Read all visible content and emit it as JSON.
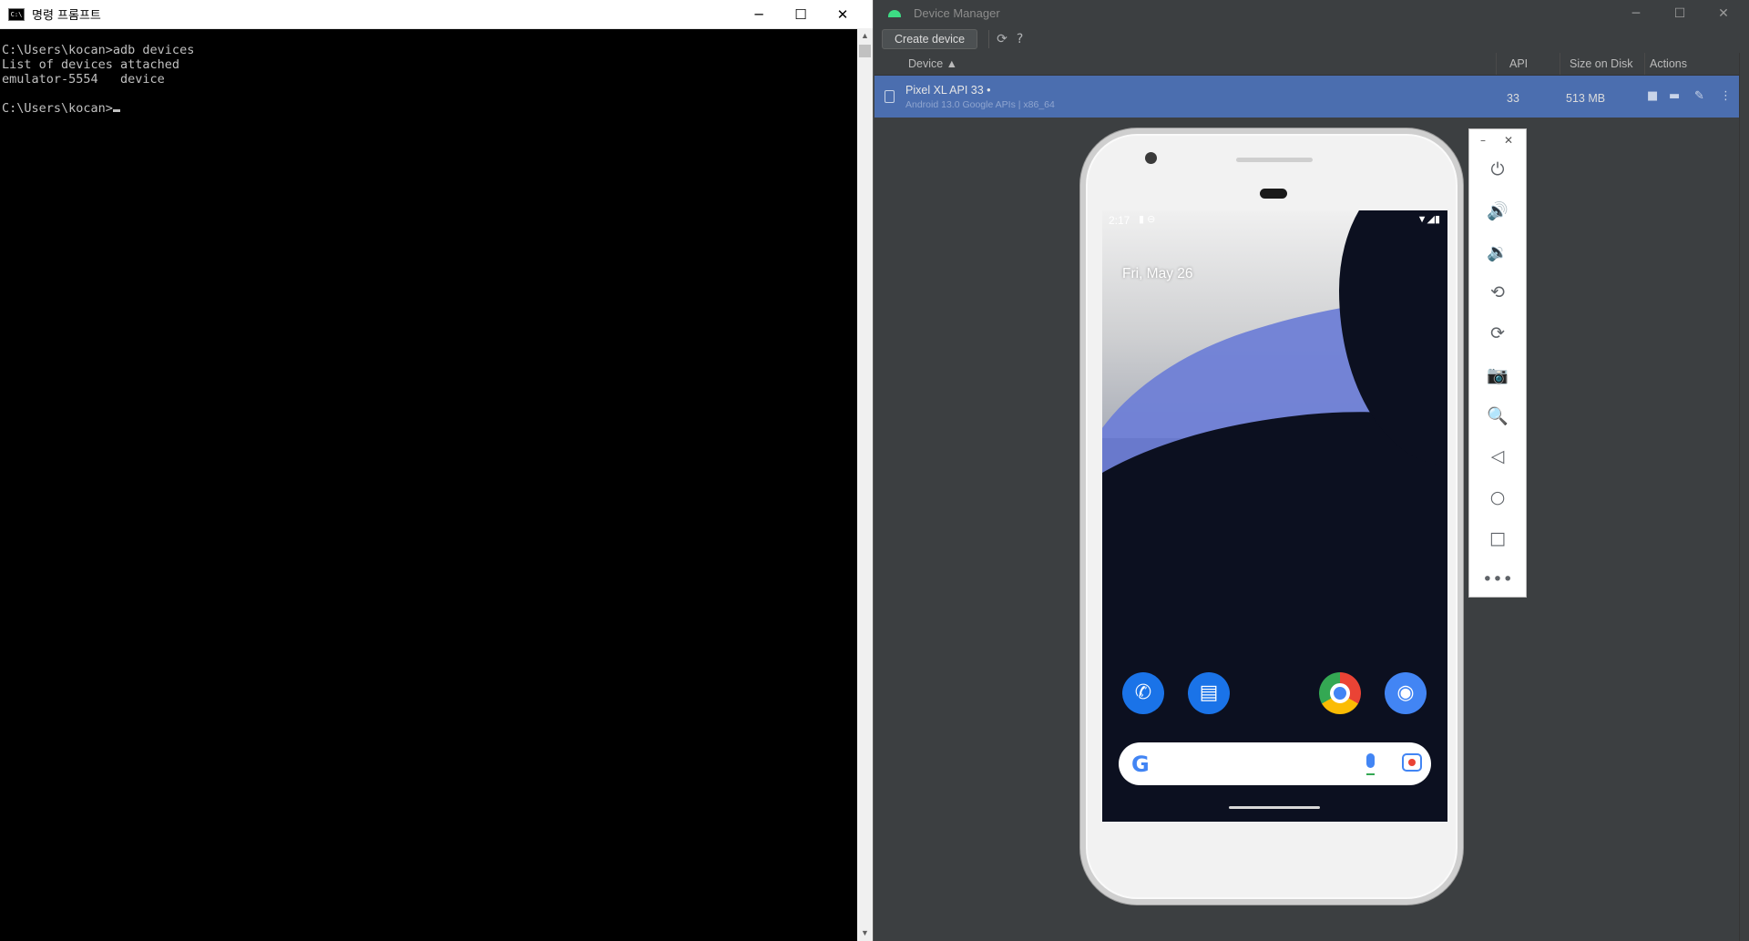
{
  "cmd": {
    "title": "명령 프롬프트",
    "icon_text": "C:\\",
    "lines": [
      "C:\\Users\\kocan>adb devices",
      "List of devices attached",
      "emulator-5554   device",
      "",
      "C:\\Users\\kocan>"
    ],
    "controls": {
      "minimize": "─",
      "maximize": "☐",
      "close": "✕"
    }
  },
  "device_manager": {
    "title": "Device Manager",
    "controls": {
      "minimize": "─",
      "maximize": "☐",
      "close": "✕"
    },
    "toolbar": {
      "create_device": "Create device",
      "refresh_icon": "⟳",
      "help_icon": "?"
    },
    "columns": {
      "device": "Device ▲",
      "api": "API",
      "size": "Size on Disk",
      "actions": "Actions"
    },
    "devices": [
      {
        "name": "Pixel XL API 33  •",
        "sub": "Android 13.0 Google APIs | x86_64",
        "api": "33",
        "size": "513 MB"
      }
    ],
    "actions": {
      "stop": "■",
      "folder": "▬",
      "edit": "✎",
      "more": "⋮"
    }
  },
  "emulator": {
    "status_time": "2:17",
    "status_left_icons": "▮ ⊖",
    "status_right_icons": "▼◢▮",
    "date": "Fri, May 26",
    "apps": {
      "phone": "✆",
      "messages": "▤",
      "camera": "◉"
    },
    "search_logo": "G",
    "toolbar": {
      "minimize": "–",
      "close": "✕",
      "buttons": [
        "⏻",
        "🔊",
        "🔉",
        "⟲",
        "⟳",
        "📷",
        "🔍",
        "◁",
        "○",
        "□",
        "•••"
      ]
    }
  },
  "colors": {
    "selection": "#4b6eaf",
    "ide_bg": "#3c3f41",
    "console_text": "#c0c0c0"
  }
}
